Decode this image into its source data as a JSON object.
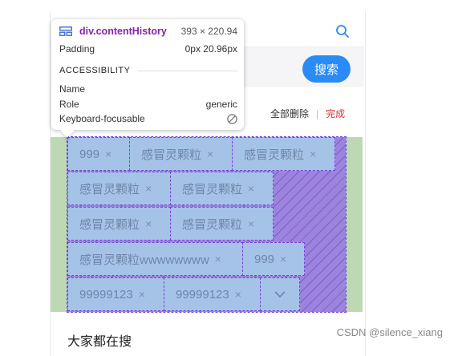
{
  "tooltip": {
    "element": "div.contentHistory",
    "dimensions": "393 × 220.94",
    "padding_label": "Padding",
    "padding_value": "0px 20.96px",
    "section_title": "ACCESSIBILITY",
    "name_label": "Name",
    "name_value": "",
    "role_label": "Role",
    "role_value": "generic",
    "focusable_label": "Keyboard-focusable"
  },
  "search": {
    "button_label": "搜索"
  },
  "history": {
    "delete_all_label": "全部删除",
    "separator": "|",
    "done_label": "完成",
    "close_glyph": "×",
    "tags": [
      "999",
      "感冒灵颗粒",
      "感冒灵颗粒",
      "感冒灵颗粒",
      "感冒灵颗粒",
      "感冒灵颗粒",
      "感冒灵颗粒",
      "感冒灵颗粒wwwwwwww",
      "999",
      "99999123",
      "99999123"
    ]
  },
  "section": {
    "everyone_searching_title": "大家都在搜"
  },
  "watermark": "CSDN @silence_xiang",
  "colors": {
    "accent_blue": "#2a8af6",
    "done_red": "#e03030",
    "devtools_element_purple": "#8a1fb0",
    "overlay_padding_green": "#bcd9b4",
    "overlay_content_blue": "#a5c3e7",
    "overlay_margin_purple": "#9c84dc"
  },
  "icons": {
    "top_search": "search-icon",
    "tooltip_layout": "flex-layout-icon",
    "not_focusable": "no-entry-icon",
    "expand": "chevron-down-icon"
  }
}
